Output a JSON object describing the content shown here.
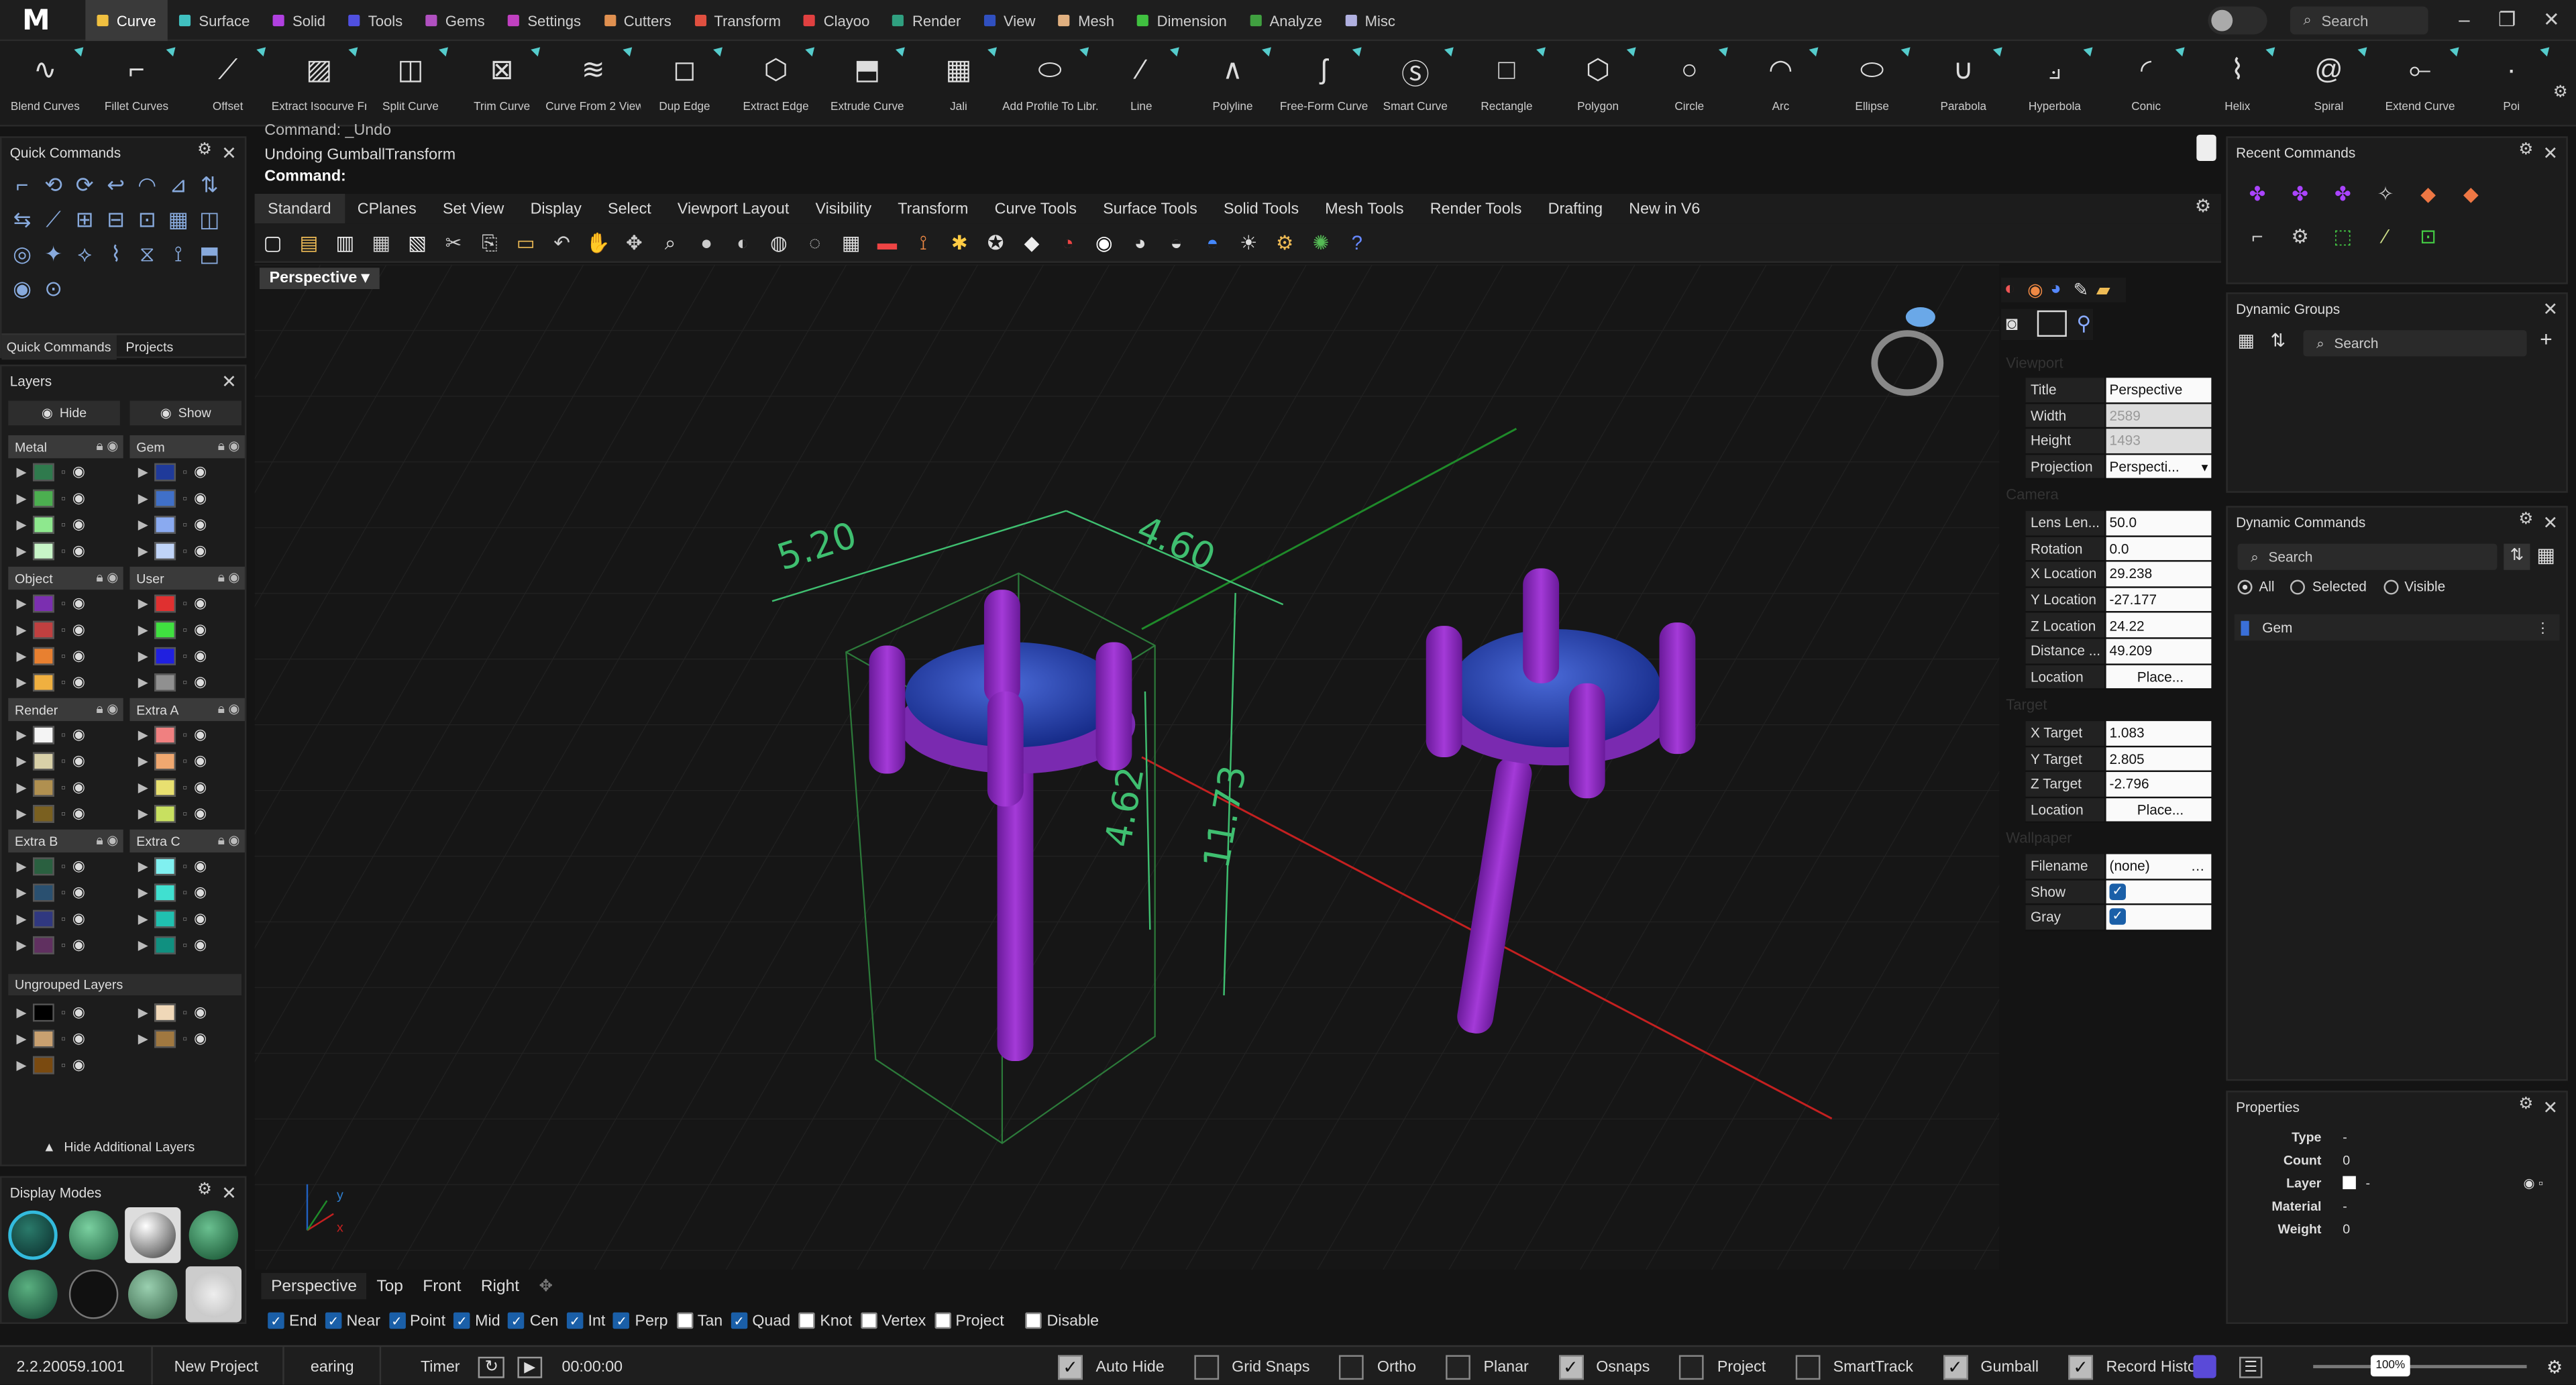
{
  "app": {
    "logo": "M"
  },
  "menu_tabs": [
    {
      "label": "Curve",
      "color": "#f0c040"
    },
    {
      "label": "Surface",
      "color": "#40c0c0"
    },
    {
      "label": "Solid",
      "color": "#b040e0"
    },
    {
      "label": "Tools",
      "color": "#5050e0"
    },
    {
      "label": "Gems",
      "color": "#b050c0"
    },
    {
      "label": "Settings",
      "color": "#c040c0"
    },
    {
      "label": "Cutters",
      "color": "#e09050"
    },
    {
      "label": "Transform",
      "color": "#e05040"
    },
    {
      "label": "Clayoo",
      "color": "#e04040"
    },
    {
      "label": "Render",
      "color": "#30a080"
    },
    {
      "label": "View",
      "color": "#3050c0"
    },
    {
      "label": "Mesh",
      "color": "#e0b080"
    },
    {
      "label": "Dimension",
      "color": "#40c040"
    },
    {
      "label": "Analyze",
      "color": "#40a040"
    },
    {
      "label": "Misc",
      "color": "#b0b0e0"
    }
  ],
  "top_search": {
    "placeholder": "Search"
  },
  "ribbon": [
    {
      "label": "Blend Curves",
      "icon": "blend-curves-icon",
      "glyph": "∿"
    },
    {
      "label": "Fillet Curves",
      "icon": "fillet-curves-icon",
      "glyph": "⌐"
    },
    {
      "label": "Offset",
      "icon": "offset-icon",
      "glyph": "⟋"
    },
    {
      "label": "Extract Isocurve Fr...",
      "icon": "extract-isocurve-icon",
      "glyph": "▨"
    },
    {
      "label": "Split Curve",
      "icon": "split-curve-icon",
      "glyph": "◫"
    },
    {
      "label": "Trim Curve",
      "icon": "trim-curve-icon",
      "glyph": "⊠"
    },
    {
      "label": "Curve From 2 Views",
      "icon": "curve-from-2-views-icon",
      "glyph": "≋"
    },
    {
      "label": "Dup Edge",
      "icon": "dup-edge-icon",
      "glyph": "◻"
    },
    {
      "label": "Extract Edge",
      "icon": "extract-edge-icon",
      "glyph": "⬡"
    },
    {
      "label": "Extrude Curve",
      "icon": "extrude-curve-icon",
      "glyph": "⬒"
    },
    {
      "label": "Jali",
      "icon": "jali-icon",
      "glyph": "▦"
    },
    {
      "label": "Add Profile To Libr...",
      "icon": "add-profile-icon",
      "glyph": "⬭"
    },
    {
      "label": "Line",
      "icon": "line-icon",
      "glyph": "⁄"
    },
    {
      "label": "Polyline",
      "icon": "polyline-icon",
      "glyph": "∧"
    },
    {
      "label": "Free-Form Curve",
      "icon": "free-form-curve-icon",
      "glyph": "ʃ"
    },
    {
      "label": "Smart Curve",
      "icon": "smart-curve-icon",
      "glyph": "Ⓢ"
    },
    {
      "label": "Rectangle",
      "icon": "rectangle-icon",
      "glyph": "□"
    },
    {
      "label": "Polygon",
      "icon": "polygon-icon",
      "glyph": "⬡"
    },
    {
      "label": "Circle",
      "icon": "circle-icon",
      "glyph": "○"
    },
    {
      "label": "Arc",
      "icon": "arc-icon",
      "glyph": "◠"
    },
    {
      "label": "Ellipse",
      "icon": "ellipse-icon",
      "glyph": "⬭"
    },
    {
      "label": "Parabola",
      "icon": "parabola-icon",
      "glyph": "∪"
    },
    {
      "label": "Hyperbola",
      "icon": "hyperbola-icon",
      "glyph": "⟓"
    },
    {
      "label": "Conic",
      "icon": "conic-icon",
      "glyph": "◜"
    },
    {
      "label": "Helix",
      "icon": "helix-icon",
      "glyph": "⌇"
    },
    {
      "label": "Spiral",
      "icon": "spiral-icon",
      "glyph": "@"
    },
    {
      "label": "Extend Curve",
      "icon": "extend-curve-icon",
      "glyph": "⟜"
    },
    {
      "label": "Poi",
      "icon": "point-icon",
      "glyph": "·"
    }
  ],
  "quick_commands": {
    "title": "Quick Commands",
    "tabs": [
      "Quick Commands",
      "Projects"
    ]
  },
  "layers": {
    "title": "Layers",
    "hide_label": "Hide",
    "show_label": "Show",
    "groups": [
      {
        "name": "Metal",
        "colors": [
          "#2f7a4d",
          "#4caf50",
          "#8ee88e",
          "#c8f5c8"
        ]
      },
      {
        "name": "Gem",
        "colors": [
          "#1f3a9a",
          "#4070c8",
          "#8aaaf0",
          "#c0d4f8"
        ]
      },
      {
        "name": "Object",
        "colors": [
          "#7b2fb0",
          "#c04040",
          "#e88030",
          "#f0b040"
        ]
      },
      {
        "name": "User",
        "colors": [
          "#e03030",
          "#40e040",
          "#2020e0",
          "#909090"
        ]
      },
      {
        "name": "Render",
        "colors": [
          "#f4f4f4",
          "#d8d0a8",
          "#b09050",
          "#7a6020"
        ]
      },
      {
        "name": "Extra A",
        "colors": [
          "#f08080",
          "#f0a870",
          "#e8e070",
          "#c8e060"
        ]
      },
      {
        "name": "Extra B",
        "colors": [
          "#2a6040",
          "#2a5070",
          "#303880",
          "#603060"
        ]
      },
      {
        "name": "Extra C",
        "colors": [
          "#80f0f0",
          "#40e0d0",
          "#20c0b0",
          "#109080"
        ]
      }
    ],
    "ungrouped_title": "Ungrouped Layers",
    "ungrouped": [
      [
        "#000000",
        "#f0d8b8"
      ],
      [
        "#c8a070",
        "#a07840"
      ],
      [
        "#7a4a10"
      ]
    ],
    "hide_additional": "Hide Additional Layers"
  },
  "display_modes": {
    "title": "Display Modes"
  },
  "command": {
    "prev": "Command: _Undo",
    "history": "Undoing GumballTransform",
    "prompt": "Command:"
  },
  "viewport_tabs": [
    "Standard",
    "CPlanes",
    "Set View",
    "Display",
    "Select",
    "Viewport Layout",
    "Visibility",
    "Transform",
    "Curve Tools",
    "Surface Tools",
    "Solid Tools",
    "Mesh Tools",
    "Render Tools",
    "Drafting",
    "New in V6"
  ],
  "viewport": {
    "label": "Perspective",
    "dims": {
      "width_a": "5.20",
      "width_b": "4.60",
      "height_a": "4.62",
      "height_b": "11.73"
    },
    "axes": {
      "x": "x",
      "y": "y"
    }
  },
  "viewport_props": {
    "section_viewport": "Viewport",
    "rows1": [
      {
        "k": "Title",
        "v": "Perspective"
      },
      {
        "k": "Width",
        "v": "2589"
      },
      {
        "k": "Height",
        "v": "1493"
      },
      {
        "k": "Projection",
        "v": "Perspecti..."
      }
    ],
    "section_camera": "Camera",
    "rows2": [
      {
        "k": "Lens Len...",
        "v": "50.0"
      },
      {
        "k": "Rotation",
        "v": "0.0"
      },
      {
        "k": "X Location",
        "v": "29.238"
      },
      {
        "k": "Y Location",
        "v": "-27.177"
      },
      {
        "k": "Z Location",
        "v": "24.22"
      },
      {
        "k": "Distance ...",
        "v": "49.209"
      },
      {
        "k": "Location",
        "v": "Place..."
      }
    ],
    "section_target": "Target",
    "rows3": [
      {
        "k": "X Target",
        "v": "1.083"
      },
      {
        "k": "Y Target",
        "v": "2.805"
      },
      {
        "k": "Z Target",
        "v": "-2.796"
      },
      {
        "k": "Location",
        "v": "Place..."
      }
    ],
    "section_wallpaper": "Wallpaper",
    "filename_k": "Filename",
    "filename_v": "(none)",
    "show_k": "Show",
    "gray_k": "Gray"
  },
  "view_tabs": [
    "Perspective",
    "Top",
    "Front",
    "Right"
  ],
  "osnaps": [
    {
      "label": "End",
      "on": true
    },
    {
      "label": "Near",
      "on": true
    },
    {
      "label": "Point",
      "on": true
    },
    {
      "label": "Mid",
      "on": true
    },
    {
      "label": "Cen",
      "on": true
    },
    {
      "label": "Int",
      "on": true
    },
    {
      "label": "Perp",
      "on": true
    },
    {
      "label": "Tan",
      "on": false
    },
    {
      "label": "Quad",
      "on": true
    },
    {
      "label": "Knot",
      "on": false
    },
    {
      "label": "Vertex",
      "on": false
    },
    {
      "label": "Project",
      "on": false
    },
    {
      "label": "Disable",
      "on": false
    }
  ],
  "status": {
    "version": "2.2.20059.1001",
    "new_project": "New Project",
    "project_name": "earing",
    "timer": "Timer",
    "time": "00:00:00",
    "toggles": [
      {
        "label": "Auto Hide",
        "on": true
      },
      {
        "label": "Grid Snaps",
        "on": false
      },
      {
        "label": "Ortho",
        "on": false
      },
      {
        "label": "Planar",
        "on": false
      },
      {
        "label": "Osnaps",
        "on": true
      },
      {
        "label": "Project",
        "on": false
      },
      {
        "label": "SmartTrack",
        "on": false
      },
      {
        "label": "Gumball",
        "on": true
      },
      {
        "label": "Record History",
        "on": true
      }
    ],
    "zoom": "100%"
  },
  "recent_commands": {
    "title": "Recent Commands"
  },
  "dynamic_groups": {
    "title": "Dynamic Groups",
    "search": "Search"
  },
  "dynamic_commands": {
    "title": "Dynamic Commands",
    "search": "Search",
    "filters": [
      "All",
      "Selected",
      "Visible"
    ],
    "items": [
      "Gem"
    ]
  },
  "properties": {
    "title": "Properties",
    "rows": [
      {
        "k": "Type",
        "v": "-"
      },
      {
        "k": "Count",
        "v": "0"
      },
      {
        "k": "Layer",
        "v": "-"
      },
      {
        "k": "Material",
        "v": "-"
      },
      {
        "k": "Weight",
        "v": "0"
      }
    ]
  }
}
